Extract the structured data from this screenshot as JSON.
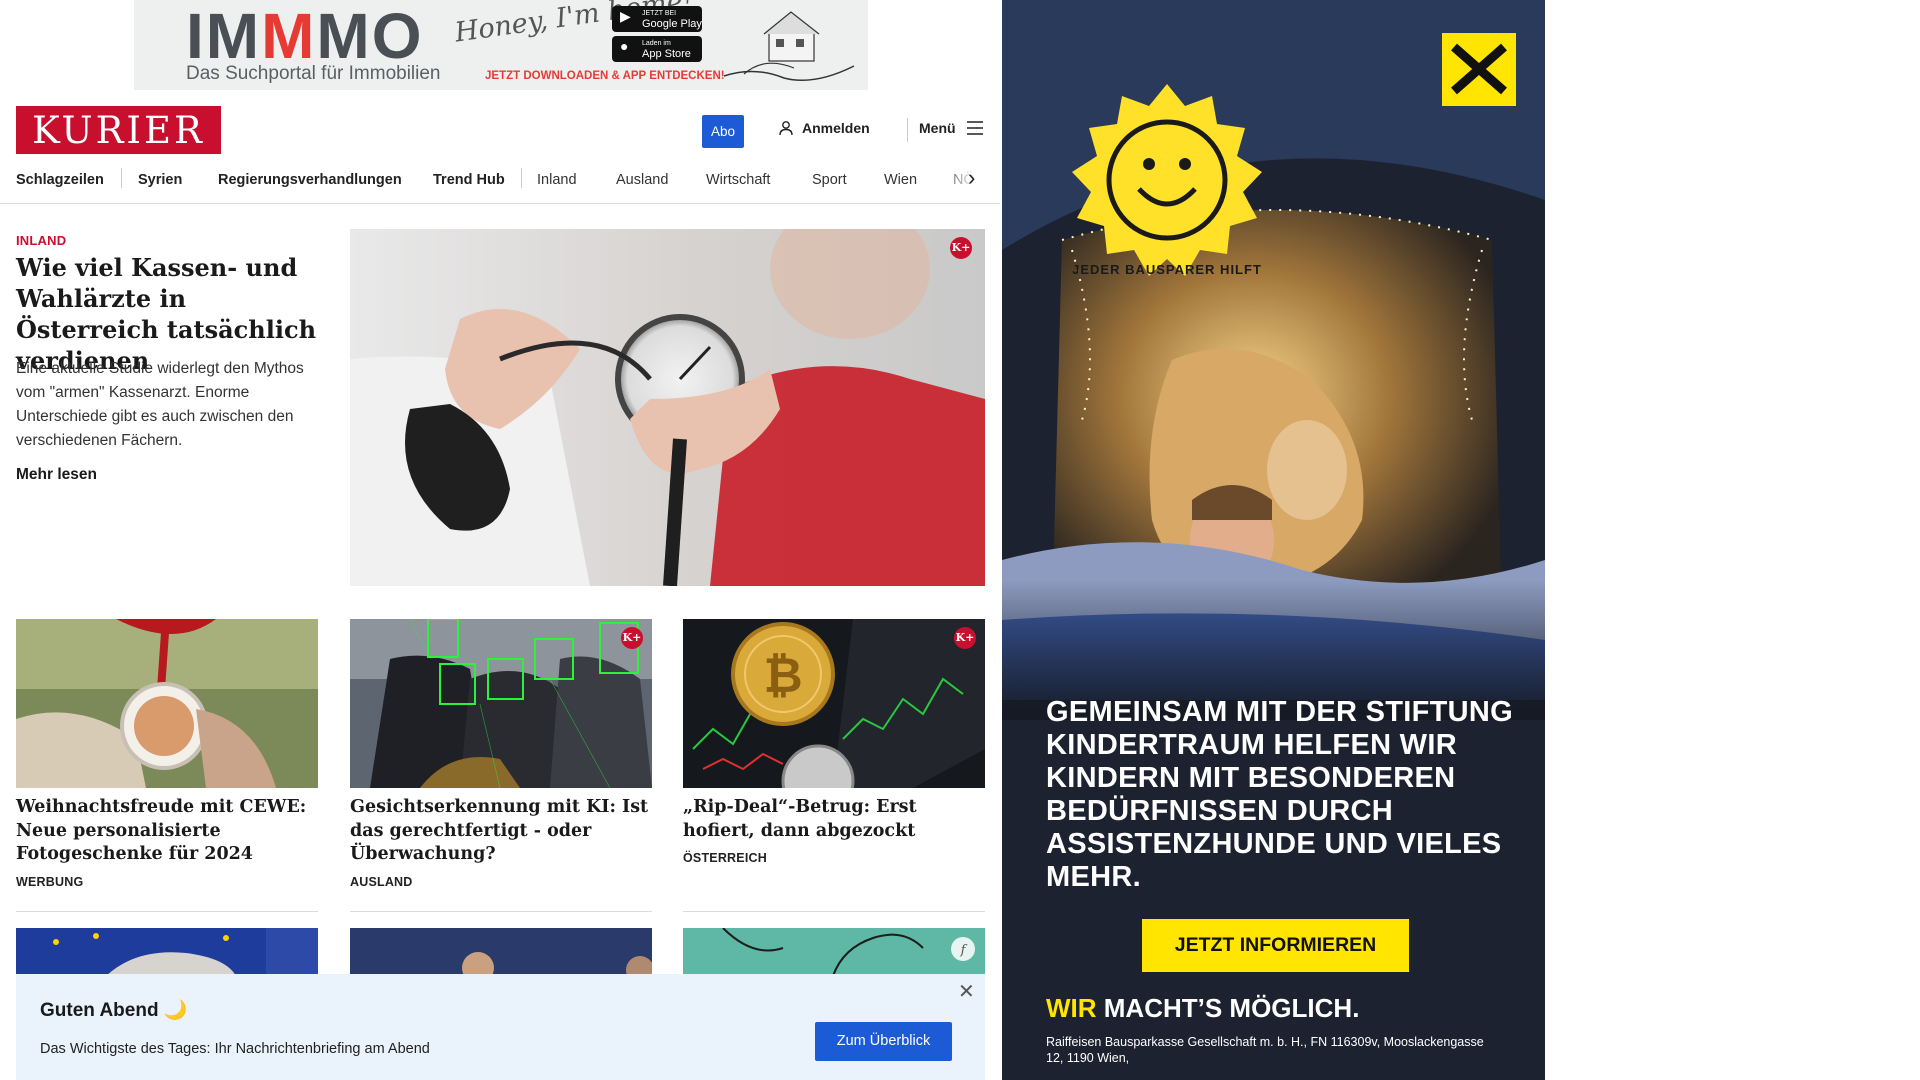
{
  "top_ad": {
    "brand_part1": "IM",
    "brand_part2": "M",
    "brand_part3": "MO",
    "tagline": "Das Suchportal für Immobilien",
    "honey": "Honey, I'm home!",
    "google_small": "JETZT BEI",
    "google": "Google Play",
    "apple_small": "Laden im",
    "apple": "App Store",
    "cta": "JETZT DOWNLOADEN & APP ENTDECKEN!"
  },
  "header": {
    "logo": "KURIER",
    "abo": "Abo",
    "login": "Anmelden",
    "menu": "Menü"
  },
  "nav": {
    "items": [
      "Schlagzeilen",
      "Syrien",
      "Regierungsverhandlungen",
      "Trend Hub",
      "Inland",
      "Ausland",
      "Wirtschaft",
      "Sport",
      "Wien",
      "NÖ"
    ]
  },
  "lead": {
    "category": "INLAND",
    "title": "Wie viel Kassen- und Wahlärzte in Österreich tatsächlich verdienen",
    "teaser": "Eine aktuelle Studie widerlegt den Mythos vom \"armen\" Kassenarzt. Enorme Unterschiede gibt es auch zwischen den verschiedenen Fächern.",
    "more": "Mehr lesen",
    "badge": "K+"
  },
  "cards": [
    {
      "title": "Weihnachtsfreude mit CEWE: Neue personalisierte Fotogeschenke für 2024",
      "category": "WERBUNG"
    },
    {
      "title": "Gesichtserkennung mit KI: Ist das gerechtfertigt - oder Überwachung?",
      "category": "AUSLAND",
      "badge": "K+"
    },
    {
      "title": "„Rip-Deal“-Betrug: Erst hofiert, dann abgezockt",
      "category": "ÖSTERREICH",
      "badge": "K+"
    }
  ],
  "briefing": {
    "title": "Guten Abend 🌙",
    "text": "Das Wichtigste des Tages: Ihr Nachrichtenbriefing am Abend",
    "button": "Zum Überblick",
    "close": "✕"
  },
  "side_ad": {
    "sticker": "JEDER BAUSPARER HILFT",
    "text": "GEMEINSAM MIT DER STIFTUNG KINDERTRAUM HELFEN WIR KINDERN MIT BESONDEREN BEDÜRFNISSEN DURCH ASSISTENZHUNDE UND VIELES MEHR.",
    "button": "JETZT INFORMIEREN",
    "slogan_part1": "WIR",
    "slogan_part2": " MACHT’S MÖGLICH.",
    "legal": "Raiffeisen Bausparkasse Gesellschaft m. b. H., FN 116309v, Mooslackengasse 12, 1190 Wien,"
  },
  "colors": {
    "brand_red": "#c80f2e",
    "accent_blue": "#1d5bd6",
    "raiffeisen_yellow": "#ffe500"
  }
}
